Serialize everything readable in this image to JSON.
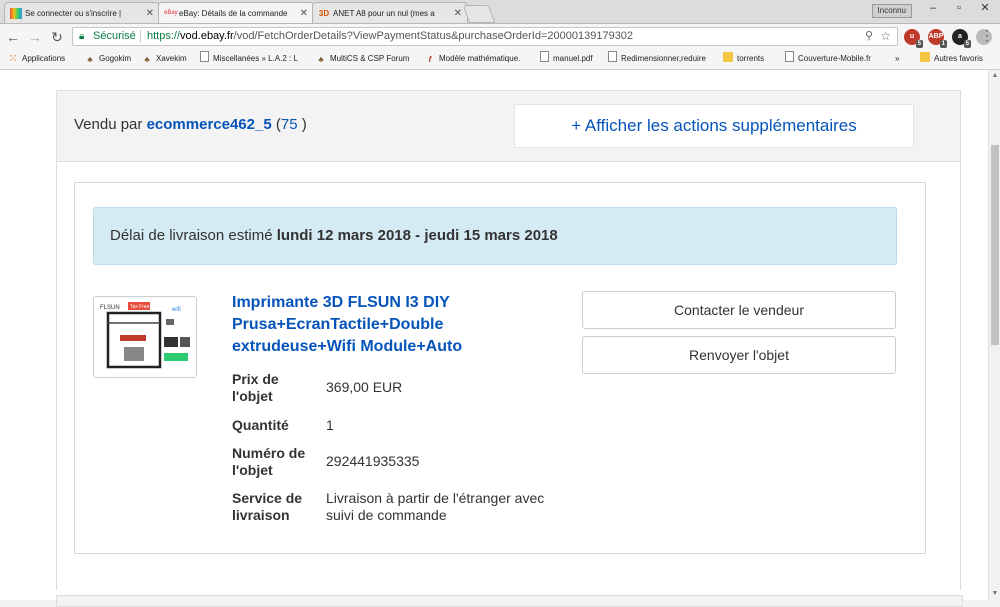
{
  "browser": {
    "tabs": [
      {
        "label": "Se connecter ou s'inscrire |",
        "active": false
      },
      {
        "label": "eBay: Détails de la commande",
        "active": true
      },
      {
        "label": "ANET A8 pour un nul (mes a",
        "active": false
      }
    ],
    "tab_icon_labels": [
      "eBay",
      "3D"
    ],
    "user_badge": "Inconnu",
    "address": {
      "secure_label": "Sécurisé",
      "url_scheme": "https://",
      "url_host": "vod.ebay.fr",
      "url_path": "/vod/FetchOrderDetails?ViewPaymentStatus&purchaseOrderId=20000139179302"
    },
    "extensions": [
      {
        "label": "u",
        "count": "5",
        "color": "#c0392b"
      },
      {
        "label": "ABP",
        "count": "1",
        "color": "#c0392b"
      },
      {
        "label": "a",
        "count": "5",
        "color": "#222222"
      },
      {
        "label": "",
        "count": "",
        "color": "#bbbbbb"
      }
    ],
    "bookmarks": [
      {
        "label": "Applications",
        "icon": "apps-grid-icon"
      },
      {
        "label": "Gogokim",
        "icon": "tree-icon"
      },
      {
        "label": "Xavekim",
        "icon": "tree-icon"
      },
      {
        "label": "Miscellanées » L.A.2 : L",
        "icon": "doc-icon"
      },
      {
        "label": "MultiCS & CSP Forum",
        "icon": "tree-icon"
      },
      {
        "label": "Modèle mathématique.",
        "icon": "f-icon"
      },
      {
        "label": "manuel.pdf",
        "icon": "doc-icon"
      },
      {
        "label": "Redimensionner,reduire",
        "icon": "doc-icon"
      },
      {
        "label": "torrents",
        "icon": "folder-icon"
      },
      {
        "label": "Couverture-Mobile.fr",
        "icon": "doc-icon"
      },
      {
        "label": "»",
        "icon": ""
      },
      {
        "label": "Autres favoris",
        "icon": "folder-icon"
      }
    ]
  },
  "seller": {
    "prefix": "Vendu par",
    "name": "ecommerce462_5",
    "open_paren": "(",
    "score": "75",
    "close_paren": ")"
  },
  "actions_button": "+ Afficher les actions supplémentaires",
  "delivery": {
    "label": "Délai de livraison estimé",
    "dates": "lundi 12 mars 2018 - jeudi 15 mars 2018"
  },
  "product": {
    "title_lines": [
      "Imprimante 3D FLSUN I3 DIY",
      "Prusa+EcranTactile+Double",
      "extrudeuse+Wifi Module+Auto"
    ],
    "thumb_brand": "FLSUN",
    "thumb_tag": "Tax Free",
    "thumb_wifi": "wifi",
    "specs": [
      {
        "label": "Prix de l'objet",
        "value": "369,00 EUR"
      },
      {
        "label": "Quantité",
        "value": "1"
      },
      {
        "label": "Numéro de l'objet",
        "value": "292441935335"
      },
      {
        "label": "Service de livraison",
        "value": "Livraison à partir de l'étranger avec suivi de commande"
      }
    ]
  },
  "buttons": {
    "contact": "Contacter le vendeur",
    "resend": "Renvoyer l'objet"
  }
}
